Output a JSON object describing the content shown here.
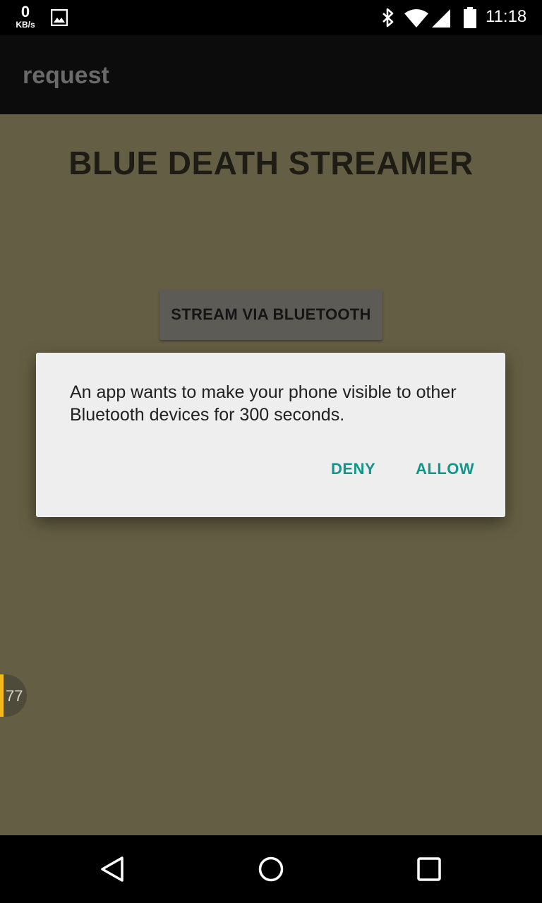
{
  "status_bar": {
    "net_speed_value": "0",
    "net_speed_unit": "KB/s",
    "time": "11:18",
    "icons": [
      "gallery-icon",
      "bluetooth-icon",
      "wifi-icon",
      "cell-signal-icon",
      "battery-icon"
    ]
  },
  "action_bar": {
    "title": "request"
  },
  "content": {
    "heading": "BLUE DEATH STREAMER",
    "stream_button_label": "STREAM VIA BLUETOOTH",
    "overlay_badge_value": "77"
  },
  "dialog": {
    "message": "An app wants to make your phone visible to other Bluetooth devices for 300 seconds.",
    "deny_label": "DENY",
    "allow_label": "ALLOW",
    "accent_color": "#11968a"
  },
  "nav_bar": {
    "icons": [
      "back-icon",
      "home-icon",
      "recents-icon"
    ]
  },
  "colors": {
    "content_background": "#645f44",
    "dialog_background": "#eeeeee",
    "badge_stripe": "#f2b81c"
  }
}
